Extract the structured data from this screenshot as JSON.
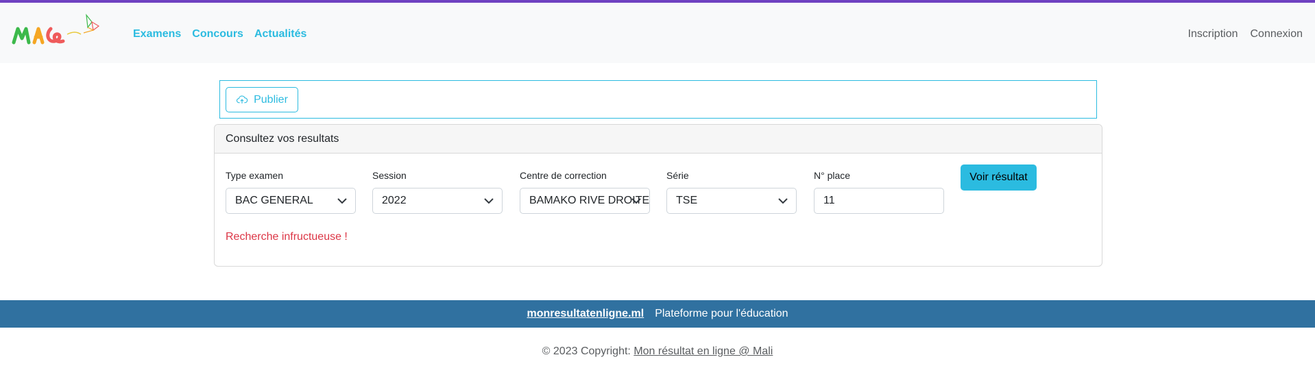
{
  "brand": {
    "logo_text": "MRL",
    "colors": {
      "primary": "#2bbbe0",
      "top_bar": "#6f42c1",
      "footer": "#3071a0",
      "error": "#dc3545"
    }
  },
  "nav": {
    "links": [
      "Examens",
      "Concours",
      "Actualités"
    ],
    "right": [
      "Inscription",
      "Connexion"
    ]
  },
  "publish": {
    "label": "Publier",
    "icon": "cloud-upload-icon"
  },
  "card": {
    "title": "Consultez vos resultats",
    "fields": [
      {
        "label": "Type examen",
        "value": "BAC GENERAL",
        "kind": "select"
      },
      {
        "label": "Session",
        "value": "2022",
        "kind": "select"
      },
      {
        "label": "Centre de correction",
        "value": "BAMAKO RIVE DROITE",
        "kind": "select"
      },
      {
        "label": "Série",
        "value": "TSE",
        "kind": "select"
      },
      {
        "label": "N° place",
        "value": "11",
        "kind": "input"
      }
    ],
    "submit_label": "Voir résultat",
    "message": "Recherche infructueuse !"
  },
  "footer": {
    "site": "monresultatenligne.ml",
    "tagline": "Plateforme pour l'éducation",
    "copyright_prefix": "© 2023 Copyright: ",
    "copyright_link": "Mon résultat en ligne @ Mali"
  }
}
